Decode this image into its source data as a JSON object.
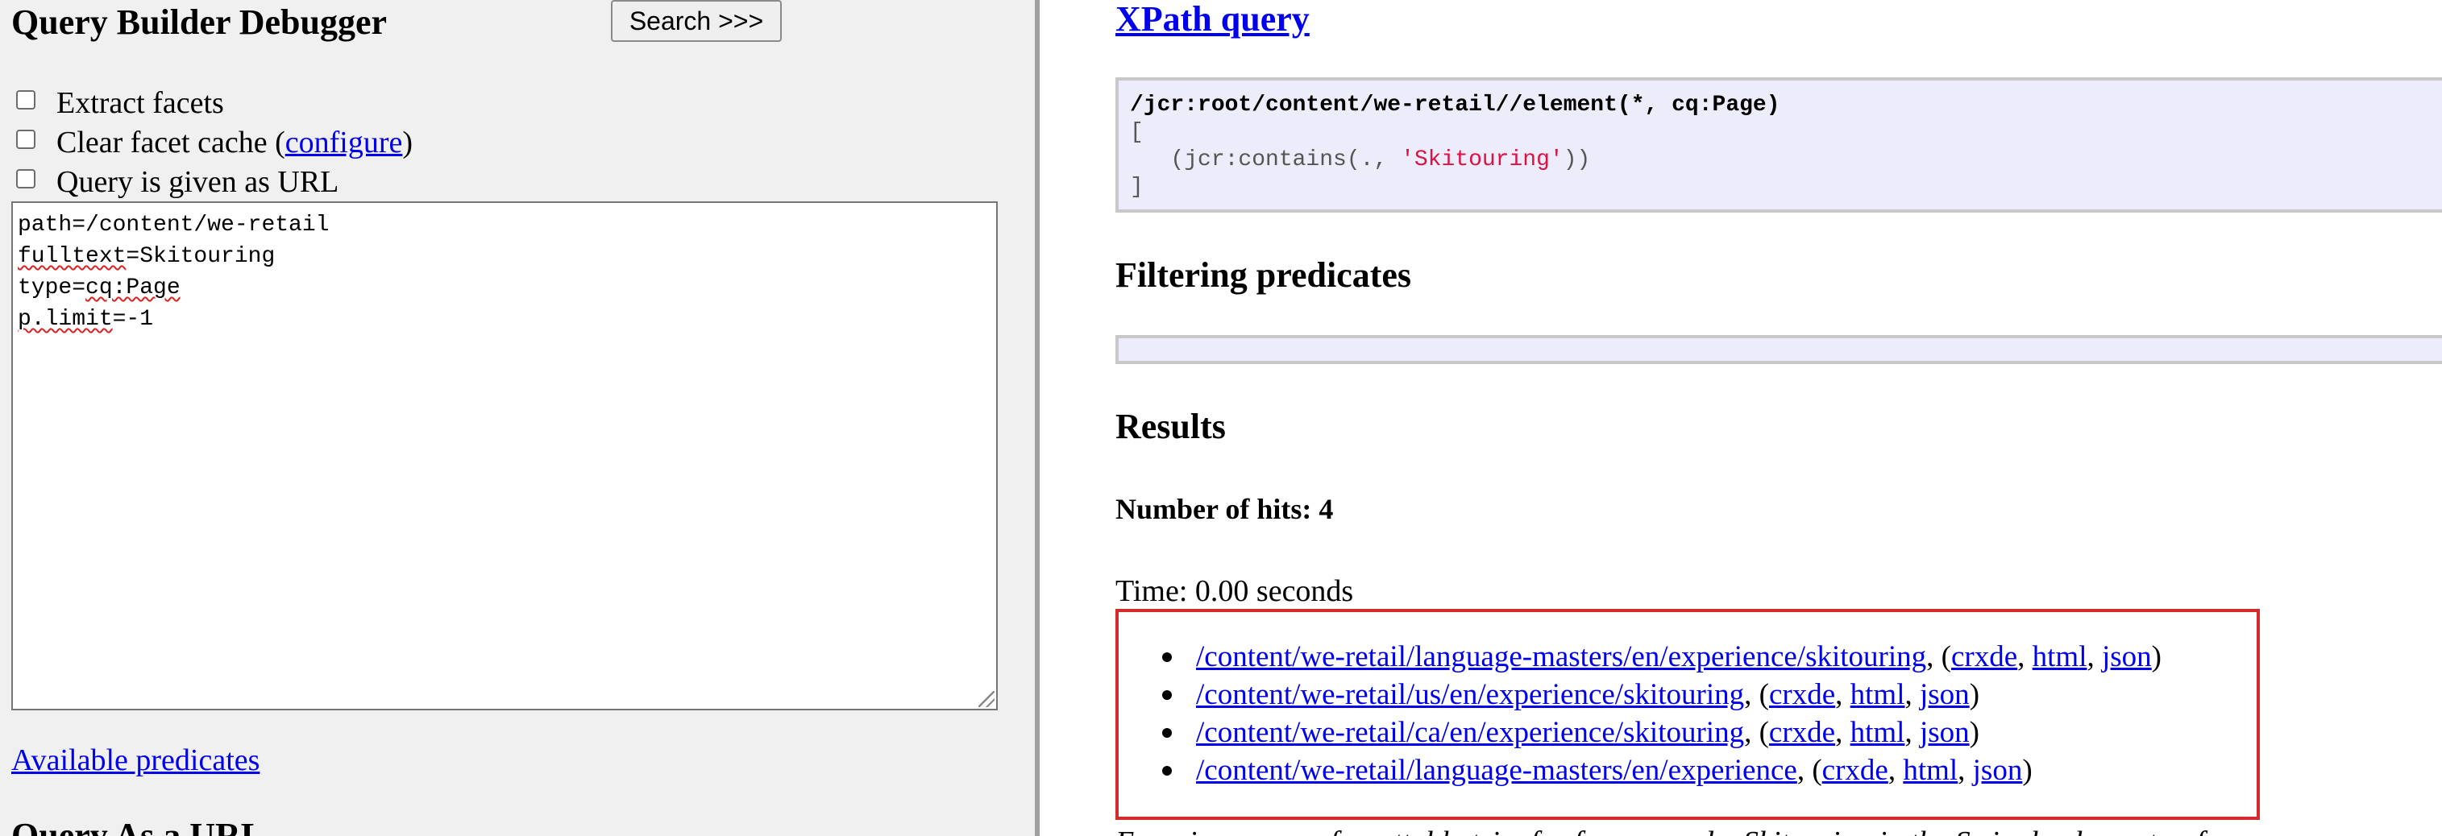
{
  "left": {
    "title": "Query Builder Debugger",
    "search_button": "Search >>>",
    "options": {
      "extract_facets": "Extract facets",
      "clear_cache_prefix": "Clear facet cache (",
      "clear_cache_link": "configure",
      "clear_cache_suffix": ")",
      "query_as_url": "Query is given as URL"
    },
    "query_lines": {
      "l1": "path=/content/we-retail",
      "l2_key": "fulltext",
      "l2_val": "=Skitouring",
      "l3_key": "type=",
      "l3_val": "cq:Page",
      "l4_key": "p.limit",
      "l4_val": "=-1"
    },
    "available_predicates": "Available predicates",
    "next_heading": "Query As a URL"
  },
  "right": {
    "xpath_title": "XPath query",
    "xpath": {
      "line1": "/jcr:root/content/we-retail//element(*, cq:Page)",
      "line2": "[",
      "line3_prefix": "   (jcr:contains(., ",
      "line3_string": "'Skitouring'",
      "line3_suffix": "))",
      "line4": "]"
    },
    "filtering_heading": "Filtering predicates",
    "results_heading": "Results",
    "hits": "Number of hits: 4",
    "time": "Time: 0.00 seconds",
    "results": [
      {
        "path": "/content/we-retail/language-masters/en/experience/skitouring",
        "sep": ", (",
        "crxde": "crxde",
        "c1": ", ",
        "html": "html",
        "c2": ", ",
        "json": "json",
        "end": ")"
      },
      {
        "path": "/content/we-retail/us/en/experience/skitouring",
        "sep": ", (",
        "crxde": "crxde",
        "c1": ", ",
        "html": "html",
        "c2": ", ",
        "json": "json",
        "end": ")"
      },
      {
        "path": "/content/we-retail/ca/en/experience/skitouring",
        "sep": ", (",
        "crxde": "crxde",
        "c1": ", ",
        "html": "html",
        "c2": ", ",
        "json": "json",
        "end": ")"
      },
      {
        "path": "/content/we-retail/language-masters/en/experience",
        "sep": ", (",
        "crxde": "crxde",
        "c1": ", ",
        "html": "html",
        "c2": ", ",
        "json": "json",
        "end": ")"
      }
    ],
    "footer": "Experience an unforgettable trip, far from crowds: Skitouring in the Swiss backcountry, for everyone, every level"
  },
  "colors": {
    "link": "#0000ee",
    "highlight_border": "#d62b2b",
    "code_bg": "#ececfa",
    "code_string": "#d14",
    "left_bg": "#f0f0f0"
  }
}
